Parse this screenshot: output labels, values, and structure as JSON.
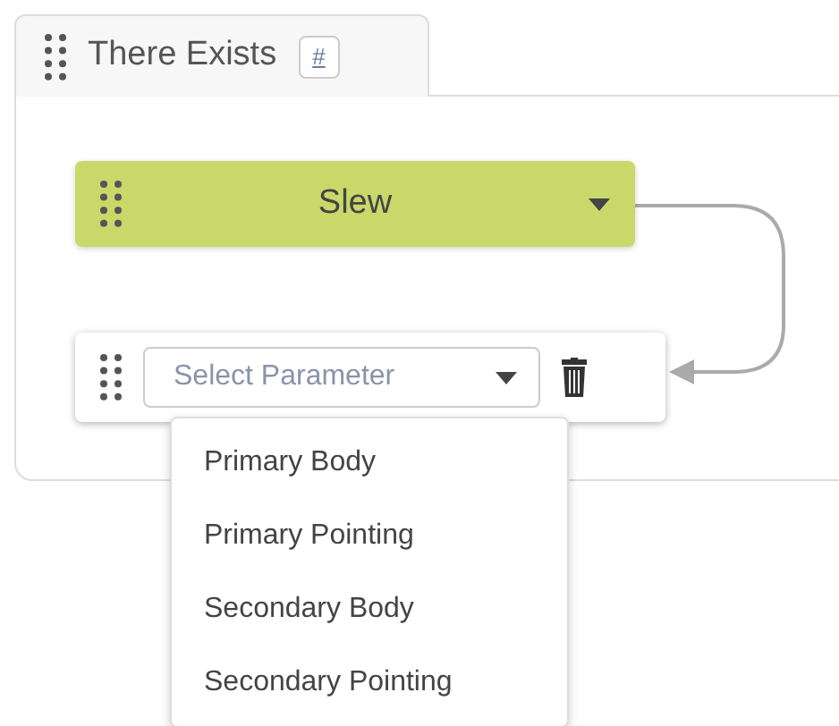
{
  "tab": {
    "title": "There Exists",
    "badge": "#"
  },
  "blocks": [
    {
      "kind": "action",
      "label": "Slew"
    },
    {
      "kind": "parameter",
      "placeholder": "Select Parameter",
      "expanded": true,
      "options": [
        {
          "label": "Primary Body",
          "selected": false
        },
        {
          "label": "Primary Pointing",
          "selected": false
        },
        {
          "label": "Secondary Body",
          "selected": false
        },
        {
          "label": "Secondary Pointing",
          "selected": false
        }
      ]
    }
  ]
}
